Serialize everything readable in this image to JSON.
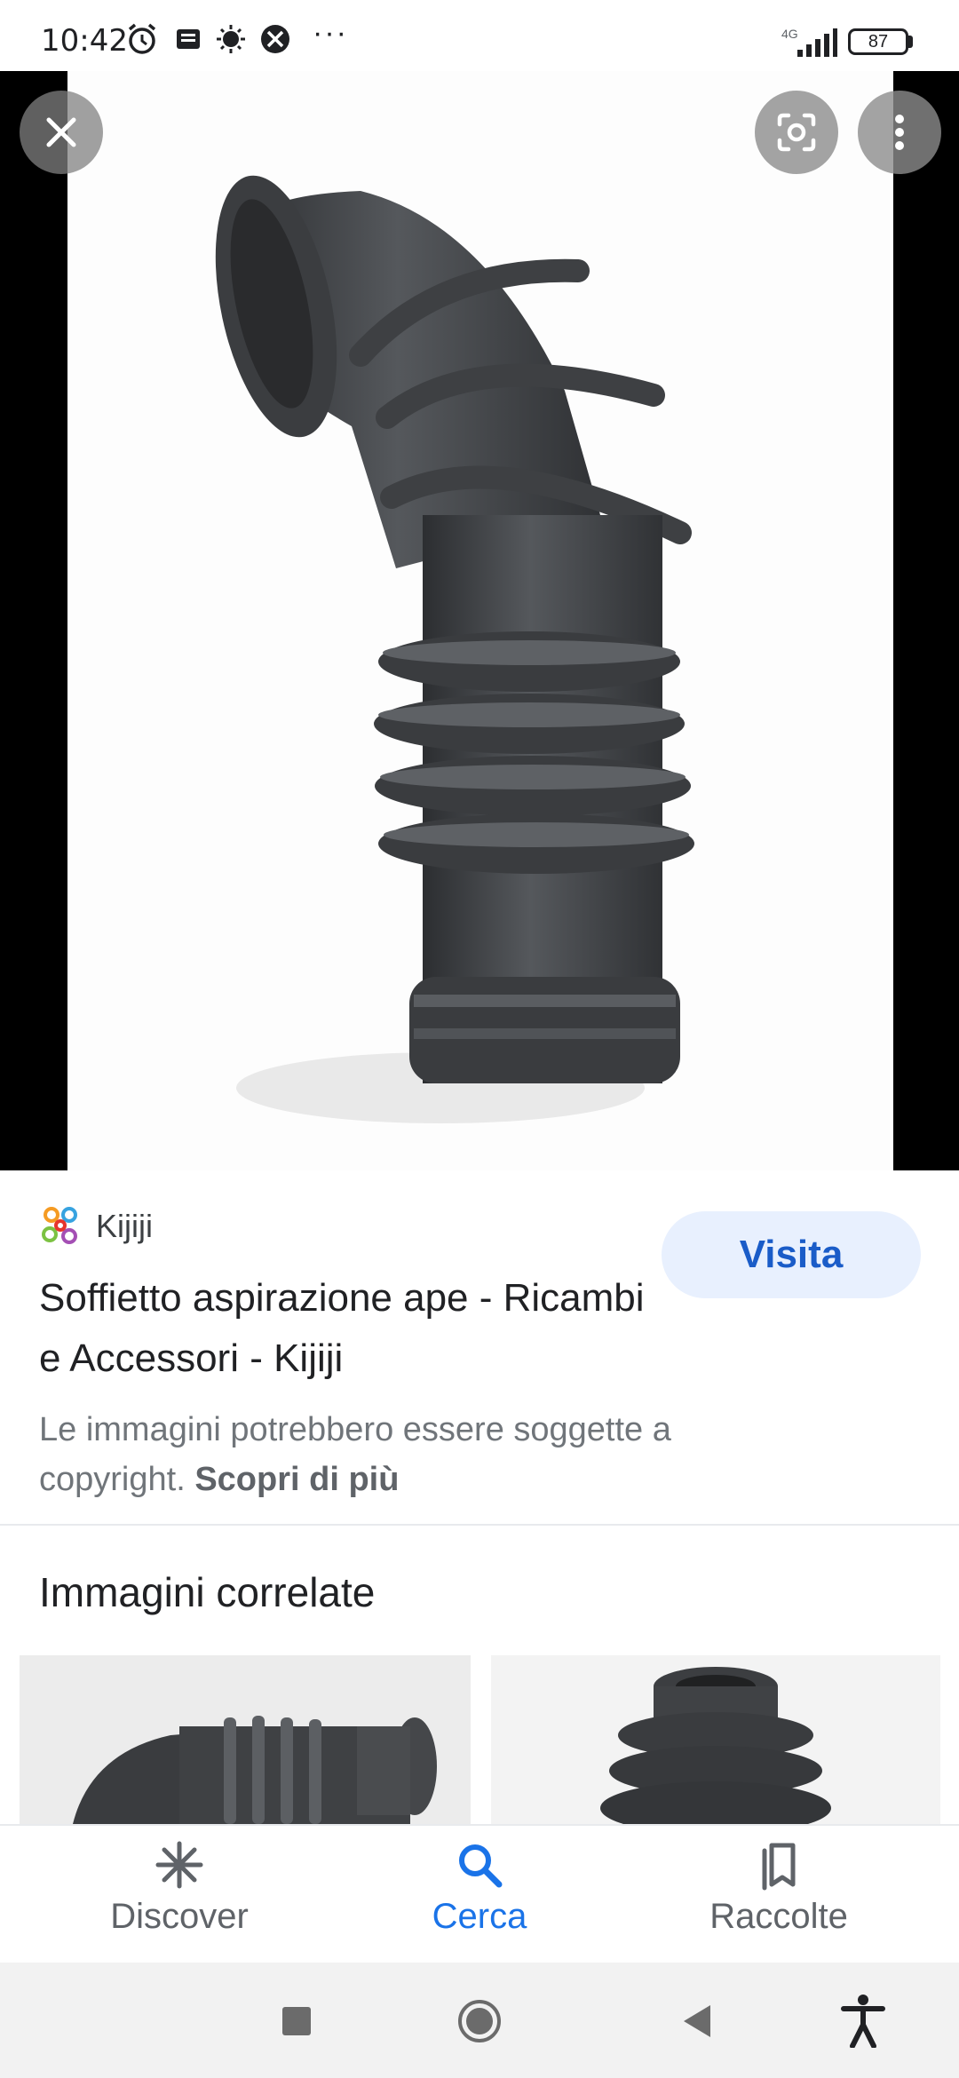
{
  "status_bar": {
    "time": "10:42",
    "network": "4G",
    "battery": "87",
    "more": "···",
    "icons": [
      "alarm-icon",
      "notification-icon",
      "brightness-icon",
      "vpn-icon",
      "signal-icon",
      "battery-icon"
    ]
  },
  "viewer": {
    "close_icon": "close-icon",
    "lens_icon": "google-lens-icon",
    "menu_icon": "more-vertical-icon"
  },
  "result": {
    "source_name": "Kijiji",
    "visit_label": "Visita",
    "title": "Soffietto aspirazione ape - Ricambi e Accessori - Kijiji",
    "copyright_text": "Le immagini potrebbero essere soggette a copyright.",
    "learn_more": "Scopri di più"
  },
  "related": {
    "title": "Immagini correlate"
  },
  "bottom_nav": {
    "items": [
      {
        "label": "Discover",
        "icon": "discover-icon"
      },
      {
        "label": "Cerca",
        "icon": "search-icon"
      },
      {
        "label": "Raccolte",
        "icon": "collections-icon"
      }
    ],
    "active_color": "#1a73e8"
  },
  "system_nav": {
    "icons": [
      "recent-apps-icon",
      "home-icon",
      "back-icon",
      "accessibility-icon"
    ]
  }
}
